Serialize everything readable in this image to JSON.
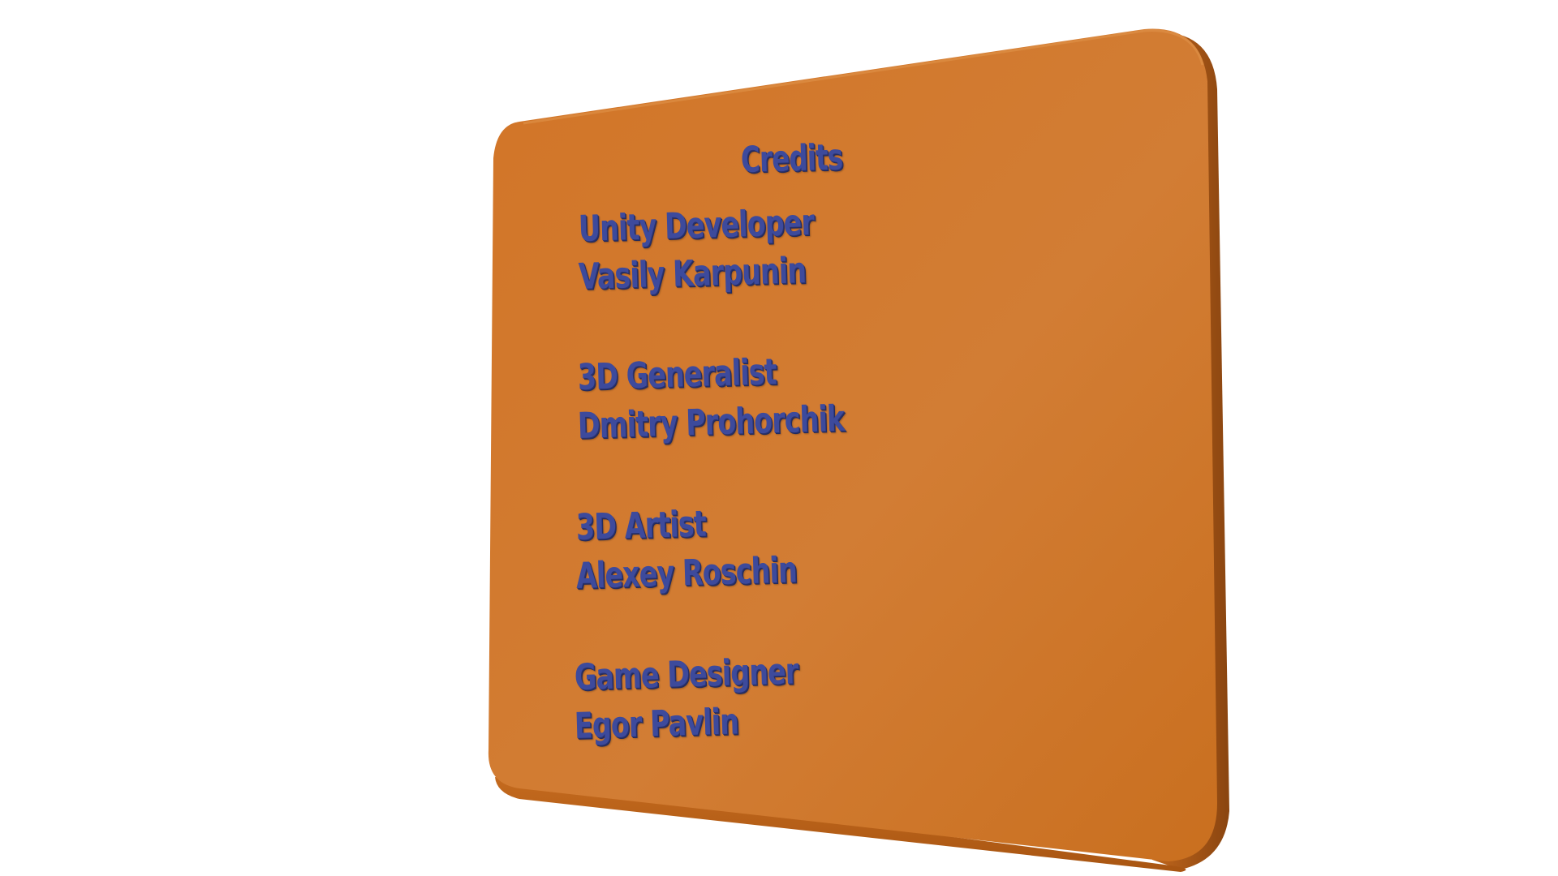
{
  "credits": {
    "title": "Credits",
    "entries": [
      {
        "role": "Unity Developer",
        "name": "Vasily Karpunin"
      },
      {
        "role": "3D Generalist",
        "name": "Dmitry Prohorchik"
      },
      {
        "role": "3D Artist",
        "name": "Alexey Roschin"
      },
      {
        "role": "Game Designer",
        "name": "Egor Pavlin"
      }
    ]
  },
  "colors": {
    "panel_front": "#d47a2a",
    "panel_side": "#9a4f14",
    "text": "#3d4a9c",
    "background": "#ffffff"
  }
}
